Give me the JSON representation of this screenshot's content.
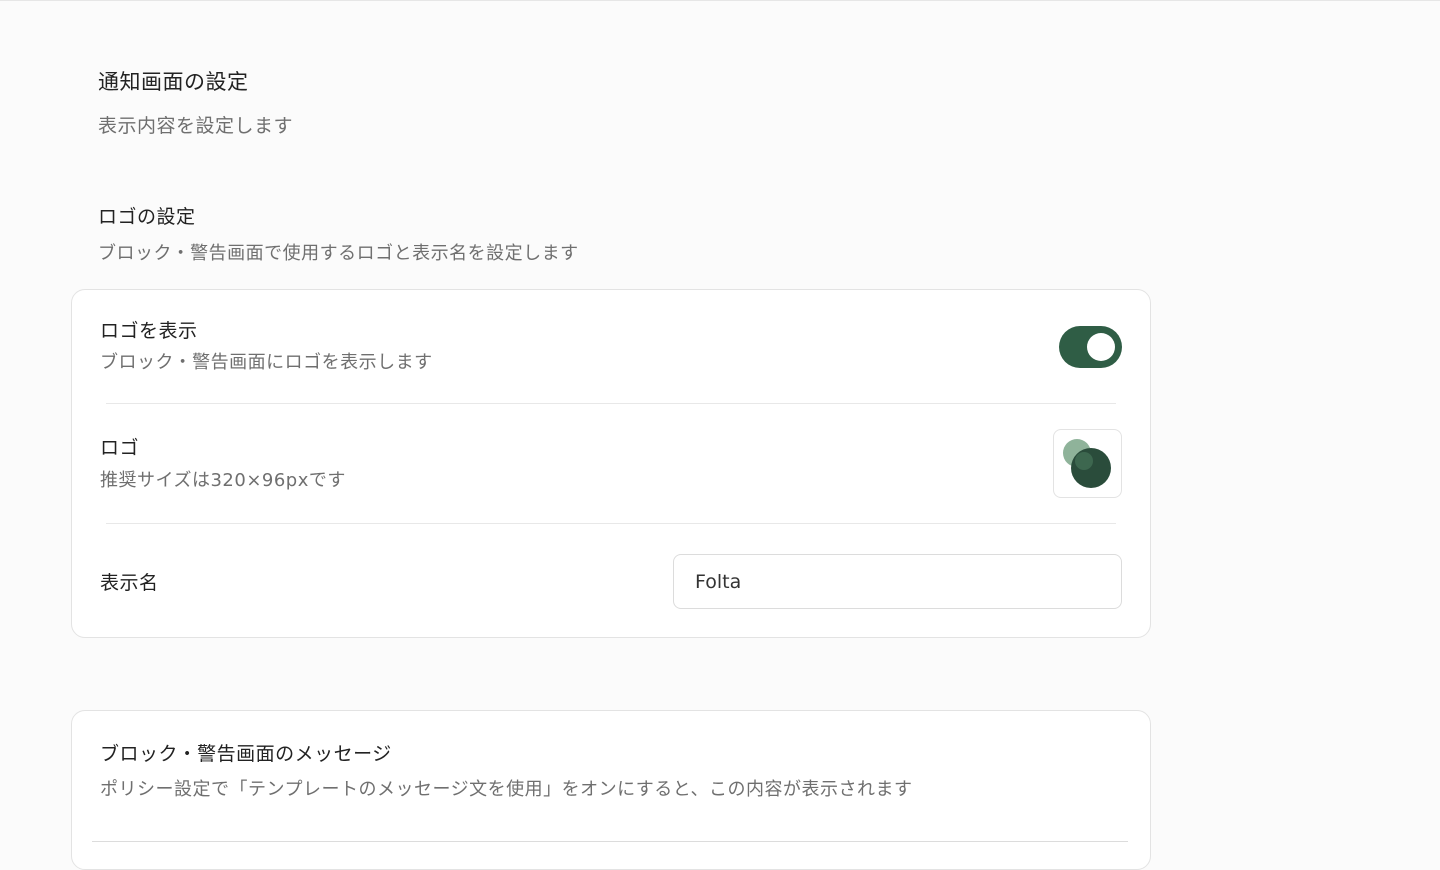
{
  "page": {
    "title": "通知画面の設定",
    "subtitle": "表示内容を設定します"
  },
  "logo_section": {
    "title": "ロゴの設定",
    "description": "ブロック・警告画面で使用するロゴと表示名を設定します",
    "show_logo": {
      "label": "ロゴを表示",
      "description": "ブロック・警告画面にロゴを表示します",
      "enabled": true
    },
    "logo": {
      "label": "ロゴ",
      "description": "推奨サイズは320×96pxです",
      "icon": "folta-logo-icon",
      "colors": {
        "light": "#8fb39a",
        "dark": "#2a4c3b"
      }
    },
    "display_name": {
      "label": "表示名",
      "value": "Folta"
    }
  },
  "message_section": {
    "title": "ブロック・警告画面のメッセージ",
    "description": "ポリシー設定で「テンプレートのメッセージ文を使用」をオンにすると、この内容が表示されます"
  },
  "colors": {
    "accent": "#2f5d45",
    "text": "#222222",
    "muted": "#6f6f6f",
    "border": "#e3e3e3"
  }
}
